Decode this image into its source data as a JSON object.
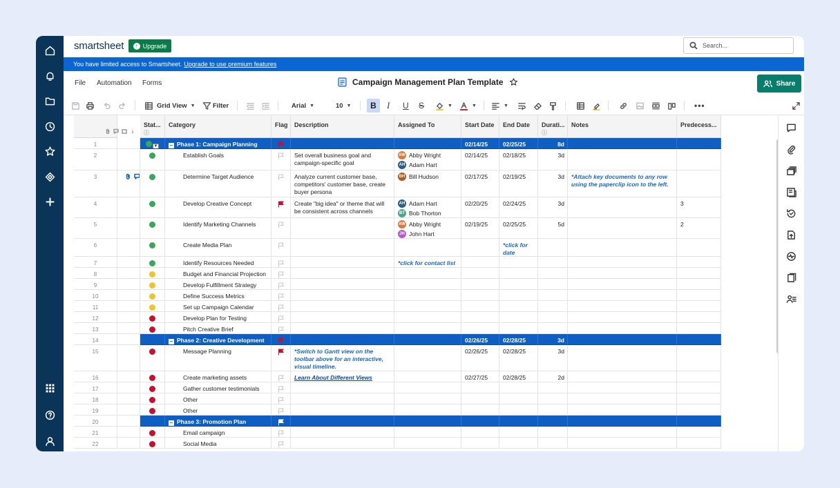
{
  "app": {
    "logo": "smartsheet",
    "upgrade_label": "Upgrade",
    "search_placeholder": "Search...",
    "banner_text": "You have limited access to Smartsheet.",
    "banner_link": "Upgrade to use premium features",
    "menu": [
      "File",
      "Automation",
      "Forms"
    ],
    "doc_title": "Campaign Management Plan Template",
    "share_label": "Share"
  },
  "toolbar": {
    "view_label": "Grid View",
    "filter_label": "Filter",
    "font": "Arial",
    "font_size": "10",
    "bold": "B",
    "italic": "I",
    "underline": "U",
    "strike": "S"
  },
  "colors": {
    "nav": "#0b3558",
    "banner": "#0b66d4",
    "phase": "#0e5ec4",
    "green": "#3aa65a",
    "yellow": "#f2c42c",
    "red": "#c8102e"
  },
  "columns": {
    "status": "Stat...",
    "category": "Category",
    "flag": "Flag",
    "description": "Description",
    "assigned": "Assigned To",
    "start": "Start Date",
    "end": "End Date",
    "duration": "Durati...",
    "notes": "Notes",
    "pred": "Predecess..."
  },
  "rows": [
    {
      "n": "1",
      "phase": true,
      "category": "Phase 1: Campaign Planning",
      "flag": "red",
      "start": "02/14/25",
      "end": "02/25/25",
      "duration": "8d",
      "status": "green-dd"
    },
    {
      "n": "2",
      "status": "green",
      "category": "Establish Goals",
      "description": "Set overall business goal and campaign-specific goal",
      "people": [
        {
          "i": "AW",
          "name": "Abby Wright",
          "c": "#d97a3c"
        },
        {
          "i": "AH",
          "name": "Adam Hart",
          "c": "#2d5f84"
        }
      ],
      "start": "02/14/25",
      "end": "02/18/25",
      "duration": "3d"
    },
    {
      "n": "3",
      "status": "green",
      "category": "Determine Target Audience",
      "description": "Analyze current customer base, competitors' customer base, create buyer persona",
      "people": [
        {
          "i": "BH",
          "name": "Bill Hudson",
          "c": "#b25a1f"
        }
      ],
      "start": "02/17/25",
      "end": "02/19/25",
      "duration": "3d",
      "notes": "*Attach key documents to any row using the paperclip icon to the left.",
      "icons": true
    },
    {
      "n": "4",
      "status": "green",
      "category": "Develop Creative Concept",
      "flag": "red",
      "description": "Create \"big idea\" or theme that will be consistent across channels",
      "people": [
        {
          "i": "AH",
          "name": "Adam Hart",
          "c": "#2d5f84"
        },
        {
          "i": "BT",
          "name": "Bob Thorton",
          "c": "#4fa58a"
        }
      ],
      "start": "02/20/25",
      "end": "02/24/25",
      "duration": "3d",
      "pred": "3"
    },
    {
      "n": "5",
      "status": "green",
      "category": "Identify Marketing Channels",
      "people": [
        {
          "i": "AW",
          "name": "Abby Wright",
          "c": "#d97a3c"
        },
        {
          "i": "JH",
          "name": "John Hart",
          "c": "#b65bc4"
        }
      ],
      "start": "02/19/25",
      "end": "02/25/25",
      "duration": "5d",
      "pred": "2"
    },
    {
      "n": "6",
      "status": "green",
      "category": "Create Media Plan",
      "end_note": "*click for date"
    },
    {
      "n": "7",
      "status": "green",
      "category": "Identify Resources Needed",
      "assigned_note": "*click for contact list"
    },
    {
      "n": "8",
      "status": "yellow",
      "category": "Budget and Financial Projection"
    },
    {
      "n": "9",
      "status": "yellow",
      "category": "Develop Fulfillment Strategy"
    },
    {
      "n": "10",
      "status": "yellow",
      "category": "Define Success Metrics"
    },
    {
      "n": "11",
      "status": "yellow",
      "category": "Set up Campaign Calendar"
    },
    {
      "n": "12",
      "status": "red",
      "category": "Develop Plan for Testing"
    },
    {
      "n": "13",
      "status": "red",
      "category": "Pitch Creative Brief"
    },
    {
      "n": "14",
      "phase": true,
      "category": "Phase 2: Creative Development",
      "flag": "red",
      "start": "02/26/25",
      "end": "02/28/25",
      "duration": "3d"
    },
    {
      "n": "15",
      "status": "red",
      "category": "Message Planning",
      "flag": "red",
      "description_note": "*Switch to Gantt view on the toolbar above for an interactive, visual timeline.",
      "start": "02/26/25",
      "end": "02/28/25",
      "duration": "3d"
    },
    {
      "n": "16",
      "status": "red",
      "category": "Create marketing assets",
      "description_link": "Learn About Different Views",
      "start": "02/27/25",
      "end": "02/28/25",
      "duration": "2d"
    },
    {
      "n": "17",
      "status": "red",
      "category": "Gather customer testimonials"
    },
    {
      "n": "18",
      "status": "red",
      "category": "Other"
    },
    {
      "n": "19",
      "status": "red",
      "category": "Other"
    },
    {
      "n": "20",
      "phase": true,
      "category": "Phase 3: Promotion Plan",
      "flag": "white"
    },
    {
      "n": "21",
      "status": "red",
      "category": "Email campaign"
    },
    {
      "n": "22",
      "status": "red",
      "category": "Social Media"
    }
  ]
}
